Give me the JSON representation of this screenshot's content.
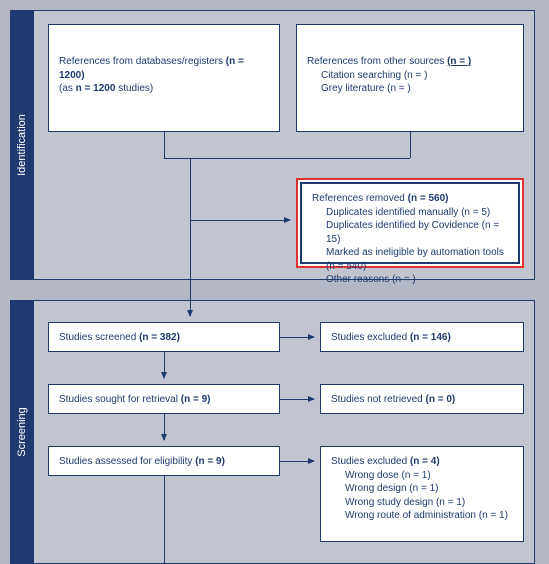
{
  "sections": {
    "identification": "Identification",
    "screening": "Screening"
  },
  "identification": {
    "databases": {
      "line1_pre": "References from databases/registers ",
      "line1_bold": "(n = 1200)",
      "line2_pre": "(as ",
      "line2_bold": "n = 1200",
      "line2_post": " studies)"
    },
    "other_sources": {
      "title_pre": "References from other sources ",
      "title_bold": "(n = )",
      "citation": "Citation searching (n = )",
      "grey": "Grey literature (n = )"
    },
    "removed": {
      "title_pre": "References removed ",
      "title_bold": "(n = 560)",
      "dup_manual": "Duplicates identified manually (n = 5)",
      "dup_cov": "Duplicates identified by Covidence (n = 15)",
      "ineligible": "Marked as ineligible by automation tools (n = 540)",
      "other": "Other reasons (n = )"
    }
  },
  "screening": {
    "screened": {
      "pre": "Studies screened ",
      "bold": "(n = 382)"
    },
    "excluded1": {
      "pre": "Studies excluded ",
      "bold": "(n = 146)"
    },
    "sought": {
      "pre": "Studies sought for retrieval ",
      "bold": "(n = 9)"
    },
    "not_retrieved": {
      "pre": "Studies not retrieved ",
      "bold": "(n = 0)"
    },
    "assessed": {
      "pre": "Studies assessed for eligibility ",
      "bold": "(n = 9)"
    },
    "excluded2": {
      "title_pre": "Studies excluded ",
      "title_bold": "(n = 4)",
      "r1": "Wrong dose (n = 1)",
      "r2": "Wrong design (n = 1)",
      "r3": "Wrong study design (n = 1)",
      "r4": "Wrong route of administration (n = 1)"
    }
  }
}
